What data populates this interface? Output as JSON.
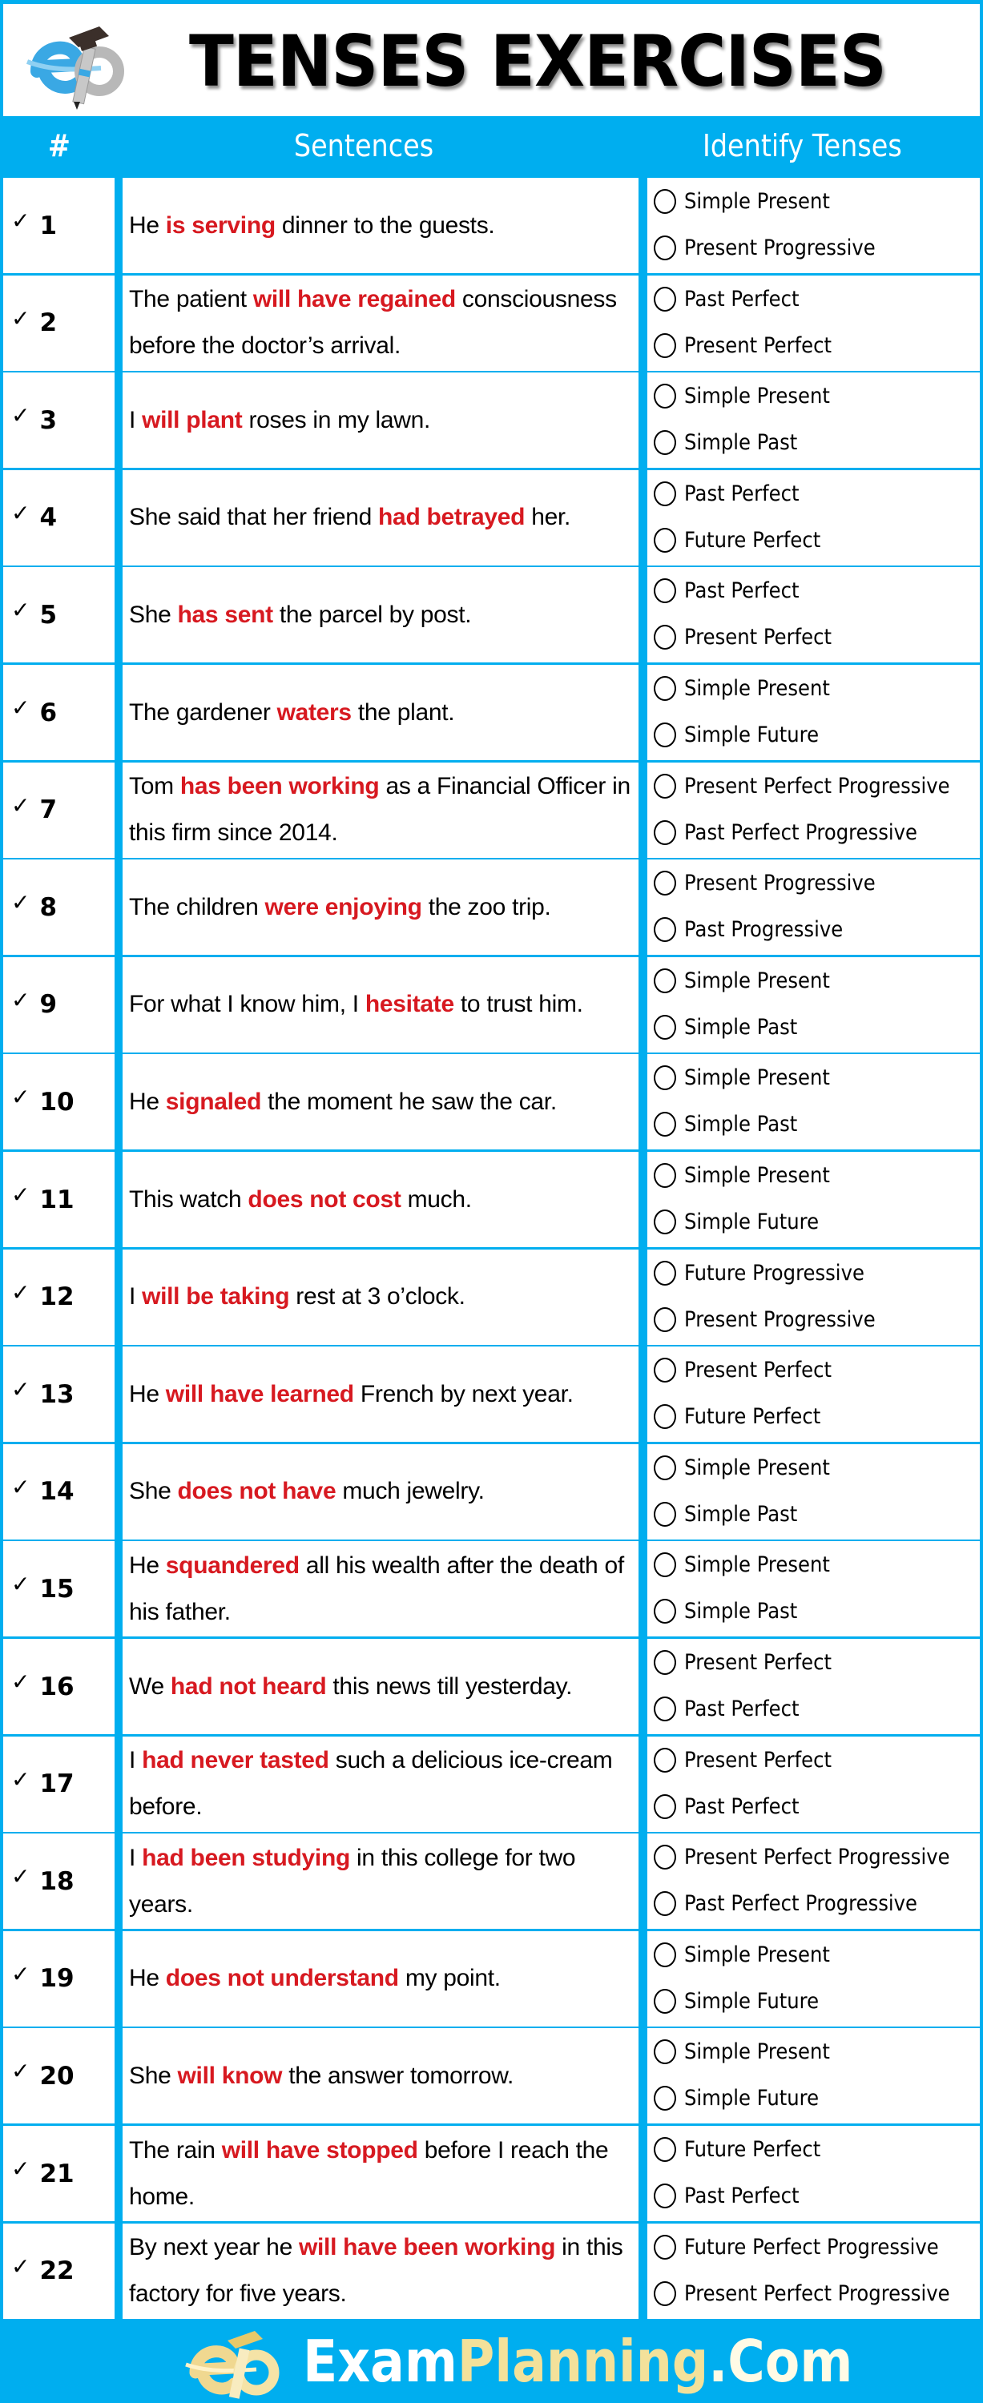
{
  "title": "TENSES EXERCISES",
  "logo_icon": "ep-logo-icon",
  "header": {
    "num": "#",
    "sentences": "Sentences",
    "tenses": "Identify Tenses"
  },
  "check_glyph": "✓",
  "colors": {
    "brand_blue": "#00aeef",
    "highlight_red": "#d71920",
    "footer_gold": "#f3e19a"
  },
  "rows": [
    {
      "num": "1",
      "pre": "He ",
      "hl": "is serving",
      "post": " dinner to the guests.",
      "options": [
        "Simple Present",
        "Present Progressive"
      ]
    },
    {
      "num": "2",
      "pre": "The patient ",
      "hl": "will have regained",
      "post": " consciousness before the doctor’s arrival.",
      "options": [
        "Past Perfect",
        "Present Perfect"
      ]
    },
    {
      "num": "3",
      "pre": "I ",
      "hl": "will plant",
      "post": " roses in my lawn.",
      "options": [
        "Simple Present",
        "Simple Past"
      ]
    },
    {
      "num": "4",
      "pre": "She said that her friend ",
      "hl": "had betrayed",
      "post": " her.",
      "options": [
        "Past Perfect",
        "Future Perfect"
      ]
    },
    {
      "num": "5",
      "pre": "She ",
      "hl": "has sent",
      "post": " the parcel by post.",
      "options": [
        "Past Perfect",
        "Present Perfect"
      ]
    },
    {
      "num": "6",
      "pre": "The gardener ",
      "hl": "waters",
      "post": " the plant.",
      "options": [
        "Simple Present",
        "Simple Future"
      ]
    },
    {
      "num": "7",
      "pre": "Tom ",
      "hl": "has been working",
      "post": " as a Financial Officer in this firm since 2014.",
      "options": [
        "Present Perfect Progressive",
        "Past Perfect Progressive"
      ]
    },
    {
      "num": "8",
      "pre": "The children ",
      "hl": "were enjoying",
      "post": " the zoo trip.",
      "options": [
        "Present Progressive",
        "Past Progressive"
      ]
    },
    {
      "num": "9",
      "pre": "For what I know him, I ",
      "hl": "hesitate",
      "post": " to trust him.",
      "options": [
        "Simple Present",
        "Simple Past"
      ]
    },
    {
      "num": "10",
      "pre": "He ",
      "hl": "signaled",
      "post": " the moment he saw the car.",
      "options": [
        "Simple Present",
        "Simple Past"
      ]
    },
    {
      "num": "11",
      "pre": "This watch ",
      "hl": "does not cost",
      "post": " much.",
      "options": [
        "Simple Present",
        "Simple Future"
      ]
    },
    {
      "num": "12",
      "pre": "I ",
      "hl": "will be taking",
      "post": " rest at 3 o’clock.",
      "options": [
        "Future Progressive",
        "Present Progressive"
      ]
    },
    {
      "num": "13",
      "pre": "He ",
      "hl": "will have learned",
      "post": " French by next year.",
      "options": [
        "Present Perfect",
        "Future Perfect"
      ]
    },
    {
      "num": "14",
      "pre": "She ",
      "hl": "does not have",
      "post": " much jewelry.",
      "options": [
        "Simple Present",
        "Simple Past"
      ]
    },
    {
      "num": "15",
      "pre": "He ",
      "hl": "squandered",
      "post": " all his wealth after the death of his father.",
      "options": [
        "Simple Present",
        "Simple Past"
      ]
    },
    {
      "num": "16",
      "pre": "We ",
      "hl": "had not heard",
      "post": " this news till yesterday.",
      "options": [
        "Present Perfect",
        "Past Perfect"
      ]
    },
    {
      "num": "17",
      "pre": "I ",
      "hl": "had never tasted",
      "post": " such a delicious ice-cream before.",
      "options": [
        "Present Perfect",
        "Past Perfect"
      ]
    },
    {
      "num": "18",
      "pre": "I ",
      "hl": "had been studying",
      "post": " in this college for two years.",
      "options": [
        "Present Perfect Progressive",
        "Past Perfect Progressive"
      ]
    },
    {
      "num": "19",
      "pre": "He ",
      "hl": "does not understand",
      "post": " my point.",
      "options": [
        "Simple Present",
        "Simple Future"
      ]
    },
    {
      "num": "20",
      "pre": "She ",
      "hl": "will know",
      "post": " the answer tomorrow.",
      "options": [
        "Simple Present",
        "Simple Future"
      ]
    },
    {
      "num": "21",
      "pre": "The rain ",
      "hl": "will have stopped",
      "post": " before I reach the home.",
      "options": [
        "Future Perfect",
        "Past Perfect"
      ]
    },
    {
      "num": "22",
      "pre": "By next year he ",
      "hl": "will have been working",
      "post": " in this factory for five years.",
      "options": [
        "Future Perfect Progressive",
        "Present Perfect Progressive"
      ]
    }
  ],
  "footer": {
    "brand_part1": "Exam",
    "brand_part2": "Planning",
    "brand_part3": ".Com"
  }
}
